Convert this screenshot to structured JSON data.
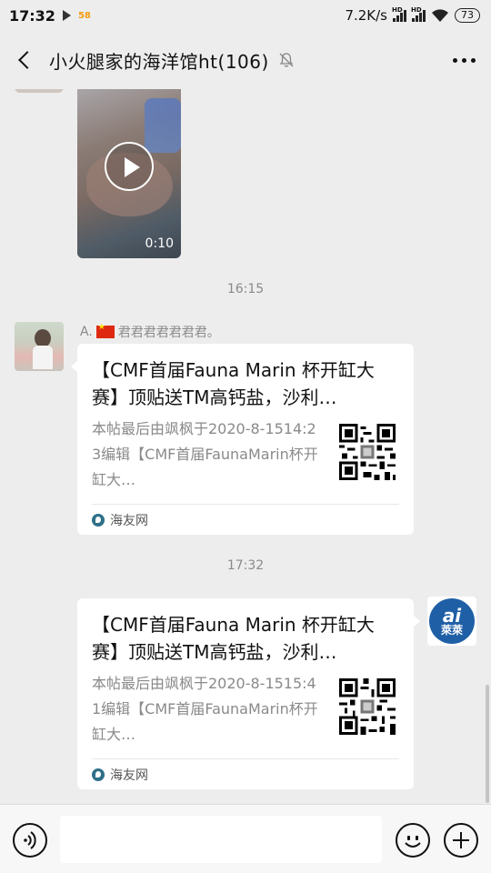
{
  "status_bar": {
    "time": "17:32",
    "app_badge": "58",
    "network_speed": "7.2K/s",
    "battery": "73"
  },
  "header": {
    "title": "小火腿家的海洋馆ht(106)",
    "back_icon": "chevron-left-icon",
    "mute_icon": "bell-off-icon",
    "more_icon": "more-dots-icon"
  },
  "messages": [
    {
      "type": "video",
      "duration": "0:10"
    },
    {
      "type": "timestamp",
      "text": "16:15"
    },
    {
      "type": "card",
      "direction": "incoming",
      "sender": "A.🇨🇳 君君君君君君君。",
      "sender_name": "君君君君君君君。",
      "title": "【CMF首届Fauna Marin 杯开缸大赛】顶贴送TM高钙盐，沙利…",
      "description": "本帖最后由飒枫于2020-8-1514:23编辑【CMF首届FaunaMarin杯开缸大…",
      "source": "海友网"
    },
    {
      "type": "timestamp",
      "text": "17:32"
    },
    {
      "type": "card",
      "direction": "outgoing",
      "title": "【CMF首届Fauna Marin 杯开缸大赛】顶贴送TM高钙盐，沙利…",
      "description": "本帖最后由飒枫于2020-8-1515:41编辑【CMF首届FaunaMarin杯开缸大…",
      "source": "海友网",
      "avatar_text_top": "ai",
      "avatar_text_bottom": "萊萊"
    }
  ],
  "input_bar": {
    "voice_icon": "voice-icon",
    "emoji_icon": "emoji-icon",
    "plus_icon": "plus-icon"
  }
}
